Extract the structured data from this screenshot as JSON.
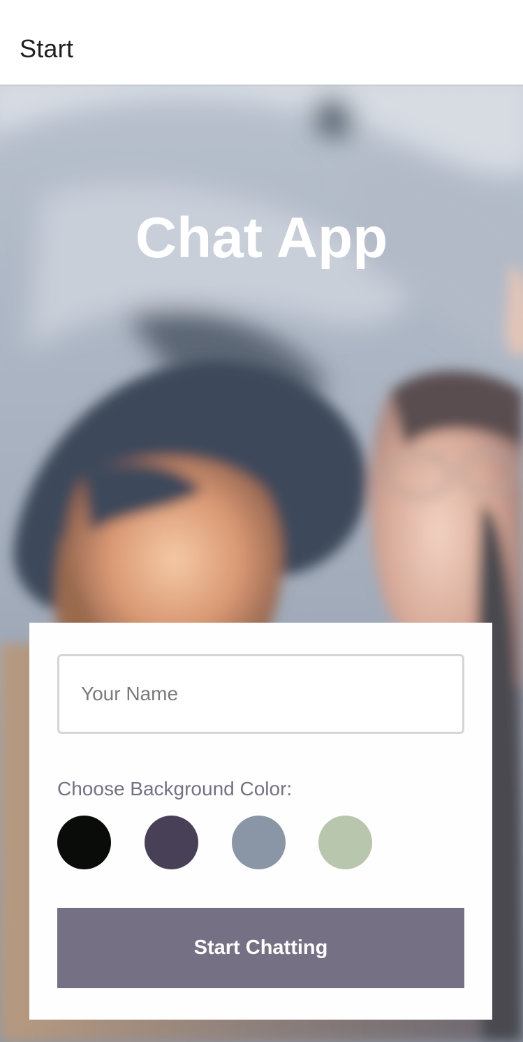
{
  "header": {
    "title": "Start"
  },
  "hero": {
    "title": "Chat App"
  },
  "form": {
    "name_placeholder": "Your Name",
    "name_value": "",
    "color_label": "Choose Background Color:",
    "colors": [
      "#090C08",
      "#474056",
      "#8A95A5",
      "#B9C6AE"
    ],
    "start_button_label": "Start Chatting",
    "button_color": "#757083"
  },
  "theme": {
    "label_color": "#757083",
    "title_color": "#FFFFFF"
  }
}
